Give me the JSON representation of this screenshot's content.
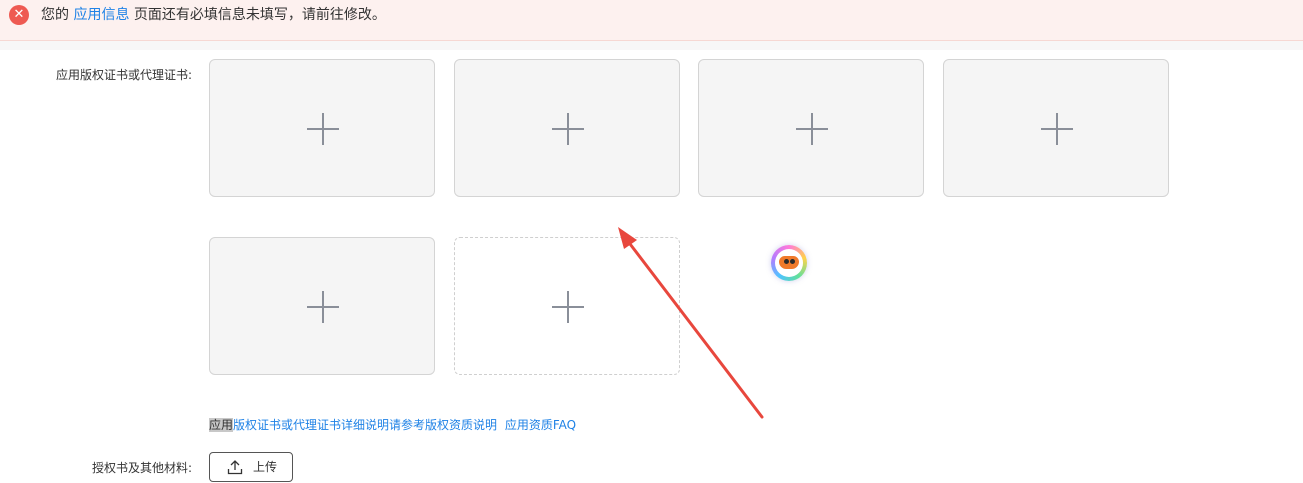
{
  "alert": {
    "icon": "close-circle-icon",
    "prefix": "您的",
    "link": "应用信息",
    "suffix": "页面还有必填信息未填写，请前往修改。"
  },
  "cert_field": {
    "label": "应用版权证书或代理证书:",
    "upload_slots": [
      {
        "state": "filled"
      },
      {
        "state": "filled"
      },
      {
        "state": "filled"
      },
      {
        "state": "filled"
      },
      {
        "state": "filled"
      },
      {
        "state": "empty"
      }
    ],
    "help": {
      "highlighted": "应用",
      "rest": "版权证书或代理证书详细说明请参考版权资质说明",
      "faq_link": "应用资质FAQ"
    }
  },
  "auth_field": {
    "label": "授权书及其他材料:",
    "upload_button": "上传"
  },
  "colors": {
    "link": "#1f82e6",
    "error": "#ee5a52",
    "annotation_arrow": "#e8473d"
  }
}
